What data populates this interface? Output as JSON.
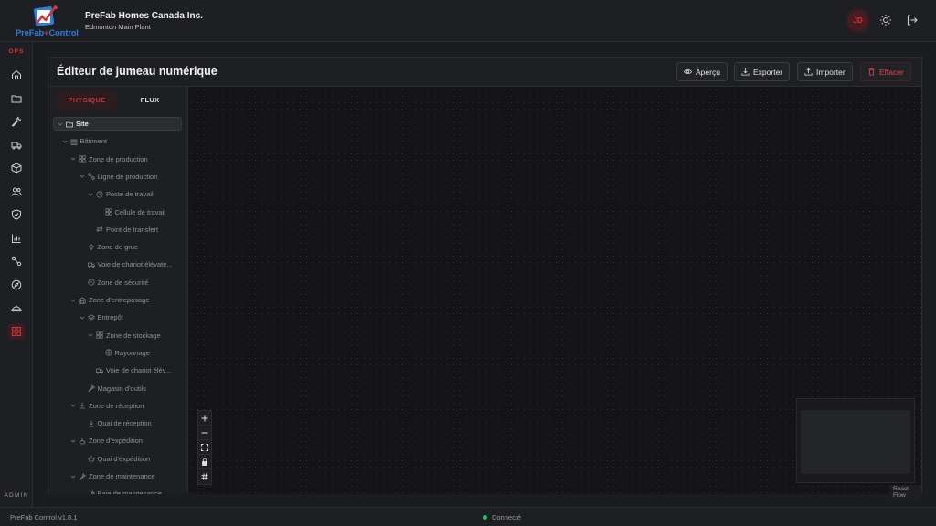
{
  "header": {
    "logo_text_left": "PreFab",
    "logo_text_right": "Control",
    "company": "PreFab Homes Canada Inc.",
    "plant": "Edmonton Main Plant",
    "avatar_initials": "JD",
    "icons": [
      "theme-toggle-icon",
      "logout-icon"
    ]
  },
  "sidebar": {
    "section_top": "OPS",
    "section_bottom": "ADMIN",
    "items": [
      {
        "icon": "home-icon"
      },
      {
        "icon": "folder-icon"
      },
      {
        "icon": "wrench-icon"
      },
      {
        "icon": "truck-icon"
      },
      {
        "icon": "box-icon"
      },
      {
        "icon": "users-icon"
      },
      {
        "icon": "shield-icon"
      },
      {
        "icon": "chart-icon"
      },
      {
        "icon": "workflow-icon"
      },
      {
        "icon": "compass-icon"
      },
      {
        "icon": "hardhat-icon"
      },
      {
        "icon": "grid-icon",
        "active": true
      }
    ]
  },
  "editor": {
    "title": "Éditeur de jumeau numérique",
    "buttons": {
      "preview": "Aperçu",
      "export": "Exporter",
      "import": "Importer",
      "clear": "Effacer"
    },
    "tabs": [
      "PHYSIQUE",
      "FLUX"
    ],
    "active_tab": "PHYSIQUE",
    "tree": [
      {
        "label": "Site",
        "depth": 0,
        "icon": "folder-icon",
        "root": true
      },
      {
        "label": "Bâtiment",
        "depth": 1,
        "icon": "building-icon"
      },
      {
        "label": "Zone de production",
        "depth": 2,
        "icon": "grid-icon"
      },
      {
        "label": "Ligne de production",
        "depth": 3,
        "icon": "workflow-icon"
      },
      {
        "label": "Poste de travail",
        "depth": 4,
        "icon": "clock-icon"
      },
      {
        "label": "Cellule de travail",
        "depth": 5,
        "icon": "grid-icon"
      },
      {
        "label": "Point de transfert",
        "depth": 4,
        "icon": "transfer-icon"
      },
      {
        "label": "Zone de grue",
        "depth": 3,
        "icon": "crane-icon"
      },
      {
        "label": "Voie de chariot élévate...",
        "depth": 3,
        "icon": "truck-icon"
      },
      {
        "label": "Zone de sécurité",
        "depth": 3,
        "icon": "clock-icon"
      },
      {
        "label": "Zone d'entreposage",
        "depth": 2,
        "icon": "warehouse-icon"
      },
      {
        "label": "Entrepôt",
        "depth": 3,
        "icon": "layers-icon"
      },
      {
        "label": "Zone de stockage",
        "depth": 4,
        "icon": "grid-icon"
      },
      {
        "label": "Rayonnage",
        "depth": 5,
        "icon": "circle-grid-icon"
      },
      {
        "label": "Voie de chariot élév...",
        "depth": 4,
        "icon": "truck-icon"
      },
      {
        "label": "Magasin d'outils",
        "depth": 3,
        "icon": "wrench-icon"
      },
      {
        "label": "Zone de réception",
        "depth": 2,
        "icon": "download-icon"
      },
      {
        "label": "Quai de réception",
        "depth": 3,
        "icon": "download-icon"
      },
      {
        "label": "Zone d'expédition",
        "depth": 2,
        "icon": "ship-icon"
      },
      {
        "label": "Quai d'expédition",
        "depth": 3,
        "icon": "ship-icon"
      },
      {
        "label": "Zone de maintenance",
        "depth": 2,
        "icon": "wrench-icon"
      },
      {
        "label": "Baie de maintenance",
        "depth": 3,
        "icon": "wrench-icon"
      }
    ],
    "attribution": "React Flow"
  },
  "footer": {
    "version": "PreFab Control v1.8.1",
    "status": "Connecté",
    "status_color": "#1ec46d"
  },
  "colors": {
    "accent": "#d8333a",
    "brand_blue": "#2a7de1",
    "background": "#1b1c1f"
  }
}
